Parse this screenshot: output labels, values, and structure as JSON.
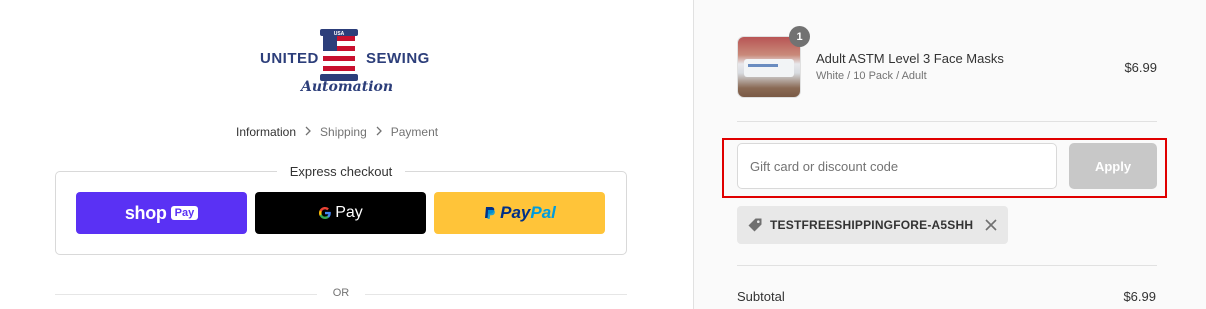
{
  "brand": {
    "word_left": "UNITED",
    "word_right": "SEWING",
    "script": "Automation",
    "badge": "USA"
  },
  "breadcrumb": [
    {
      "label": "Information",
      "active": true
    },
    {
      "label": "Shipping",
      "active": false
    },
    {
      "label": "Payment",
      "active": false
    }
  ],
  "express": {
    "title": "Express checkout",
    "shop_pay": {
      "label": "shop",
      "badge": "Pay"
    },
    "google_pay": {
      "label": "Pay"
    },
    "paypal": {
      "label_pay": "Pay",
      "label_pal": "Pal"
    }
  },
  "divider_text": "OR",
  "summary": {
    "product": {
      "quantity": "1",
      "name": "Adult ASTM Level 3 Face Masks",
      "variant": "White / 10 Pack / Adult",
      "price": "$6.99"
    },
    "discount": {
      "placeholder": "Gift card or discount code",
      "apply_label": "Apply"
    },
    "applied_code": "TESTFREESHIPPINGFORE-A5SHH",
    "subtotal_label": "Subtotal",
    "subtotal_value": "$6.99"
  },
  "colors": {
    "shop_pay": "#5a31f4",
    "google_pay": "#000000",
    "paypal": "#ffc439",
    "highlight": "#e00000",
    "apply_disabled": "#c8c8c8"
  }
}
